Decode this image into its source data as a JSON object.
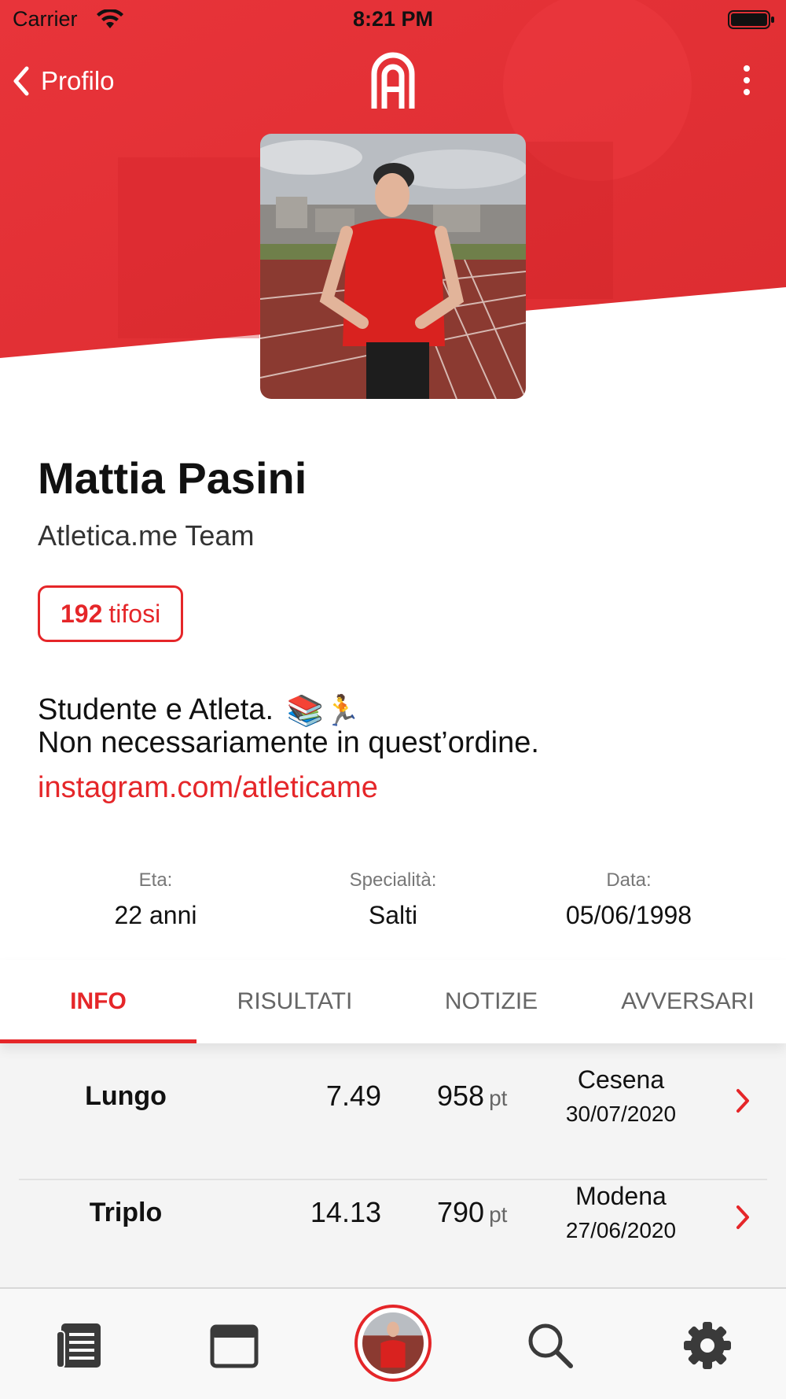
{
  "status_bar": {
    "carrier": "Carrier",
    "time": "8:21 PM"
  },
  "nav": {
    "back_label": "Profilo",
    "back_icon": "chevron-left-icon",
    "logo": "atletica-logo",
    "more_icon": "more-vertical-icon"
  },
  "profile": {
    "name": "Mattia Pasini",
    "team": "Atletica.me Team",
    "fans_count": "192",
    "fans_label": "tifosi",
    "bio_line1": "Studente e Atleta.",
    "bio_emoji": "📚🏃",
    "bio_line2": "Non necessariamente in quest’ordine.",
    "link": "instagram.com/atleticame"
  },
  "stats": [
    {
      "label": "Eta:",
      "value": "22 anni"
    },
    {
      "label": "Specialità:",
      "value": "Salti"
    },
    {
      "label": "Data:",
      "value": "05/06/1998"
    }
  ],
  "tabs": [
    {
      "label": "INFO",
      "active": true
    },
    {
      "label": "RISULTATI",
      "active": false
    },
    {
      "label": "NOTIZIE",
      "active": false
    },
    {
      "label": "AVVERSARI",
      "active": false
    }
  ],
  "results": [
    {
      "event": "Lungo",
      "measure": "7.49",
      "points": "958",
      "unit": "pt",
      "place": "Cesena",
      "date": "30/07/2020"
    },
    {
      "event": "Triplo",
      "measure": "14.13",
      "points": "790",
      "unit": "pt",
      "place": "Modena",
      "date": "27/06/2020"
    }
  ],
  "tabbar": [
    {
      "name": "news-icon"
    },
    {
      "name": "calendar-icon"
    },
    {
      "name": "profile-avatar"
    },
    {
      "name": "search-icon"
    },
    {
      "name": "settings-gear-icon"
    }
  ],
  "colors": {
    "accent": "#e52629",
    "list_bg": "#f4f4f4"
  }
}
